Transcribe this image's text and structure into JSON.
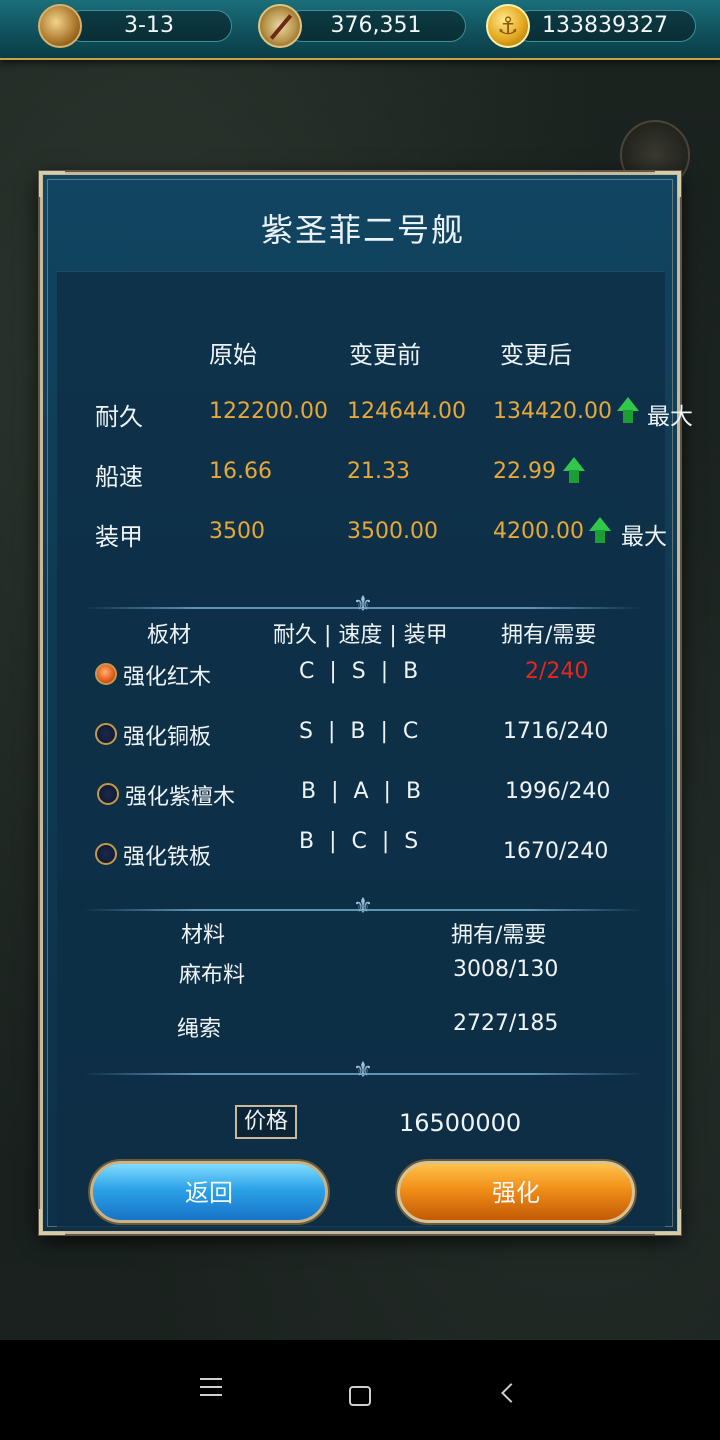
{
  "topbar": {
    "stage": "3-13",
    "navigation_points": "376,351",
    "gold": "133839327"
  },
  "dialog": {
    "title": "紫圣菲二号舰",
    "columns": [
      "原始",
      "变更前",
      "变更后"
    ],
    "stats": [
      {
        "name": "耐久",
        "original": "122200.00",
        "before": "124644.00",
        "after": "134420.00",
        "up": true,
        "max_label": "最大"
      },
      {
        "name": "船速",
        "original": "16.66",
        "before": "21.33",
        "after": "22.99",
        "up": true,
        "max_label": ""
      },
      {
        "name": "装甲",
        "original": "3500",
        "before": "3500.00",
        "after": "4200.00",
        "up": true,
        "max_label": "最大"
      }
    ],
    "plates_header": {
      "material": "板材",
      "grades": "耐久 | 速度 | 装甲",
      "owned": "拥有/需要"
    },
    "plates": [
      {
        "name": "强化红木",
        "grades": "C | S | B",
        "owned": "2/240",
        "selected": true,
        "insufficient": true
      },
      {
        "name": "强化铜板",
        "grades": "S | B | C",
        "owned": "1716/240",
        "selected": false,
        "insufficient": false
      },
      {
        "name": "强化紫檀木",
        "grades": "B | A | B",
        "owned": "1996/240",
        "selected": false,
        "insufficient": false
      },
      {
        "name": "强化铁板",
        "grades": "B | C | S",
        "owned": "1670/240",
        "selected": false,
        "insufficient": false
      }
    ],
    "materials_header": {
      "material": "材料",
      "owned": "拥有/需要"
    },
    "materials": [
      {
        "name": "麻布料",
        "owned": "3008/130"
      },
      {
        "name": "绳索",
        "owned": "2727/185"
      }
    ],
    "price_label": "价格",
    "price_value": "16500000",
    "back_button": "返回",
    "strengthen_button": "强化"
  },
  "colors": {
    "value_gold": "#e7a838",
    "insufficient_red": "#e8261d",
    "arrow_green": "#2fc84a"
  }
}
